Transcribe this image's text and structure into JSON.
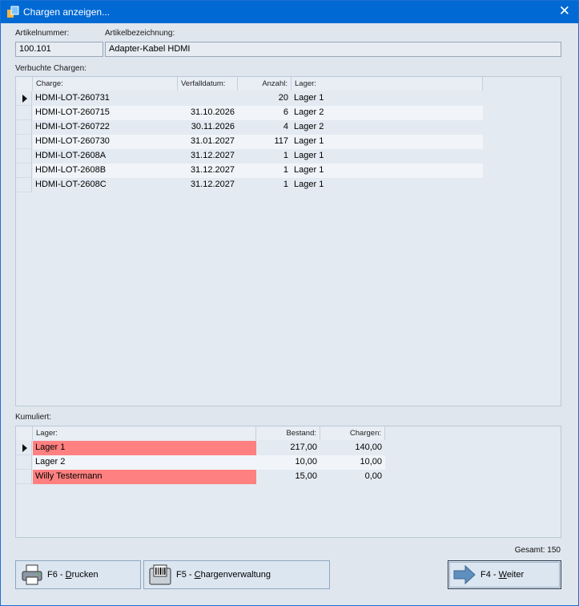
{
  "window": {
    "title": "Chargen anzeigen...",
    "close_glyph": "✕",
    "accent": "#0069d4"
  },
  "article": {
    "number_label": "Artikelnummer:",
    "number_value": "100.101",
    "desc_label": "Artikelbezeichnung:",
    "desc_value": "Adapter-Kabel HDMI"
  },
  "booked": {
    "section_label": "Verbuchte Chargen:",
    "columns": {
      "charge": "Charge:",
      "expiry": "Verfalldatum:",
      "count": "Anzahl:",
      "storage": "Lager:"
    },
    "rows": [
      {
        "charge": "HDMI-LOT-260731",
        "expiry": "",
        "count": "20",
        "storage": "Lager 1"
      },
      {
        "charge": "HDMI-LOT-260715",
        "expiry": "31.10.2026",
        "count": "6",
        "storage": "Lager 2"
      },
      {
        "charge": "HDMI-LOT-260722",
        "expiry": "30.11.2026",
        "count": "4",
        "storage": "Lager 2"
      },
      {
        "charge": "HDMI-LOT-260730",
        "expiry": "31.01.2027",
        "count": "117",
        "storage": "Lager 1"
      },
      {
        "charge": "HDMI-LOT-2608A",
        "expiry": "31.12.2027",
        "count": "1",
        "storage": "Lager 1"
      },
      {
        "charge": "HDMI-LOT-2608B",
        "expiry": "31.12.2027",
        "count": "1",
        "storage": "Lager 1"
      },
      {
        "charge": "HDMI-LOT-2608C",
        "expiry": "31.12.2027",
        "count": "1",
        "storage": "Lager 1"
      }
    ]
  },
  "cumulative": {
    "section_label": "Kumuliert:",
    "columns": {
      "storage": "Lager:",
      "stock": "Bestand:",
      "charges": "Chargen:"
    },
    "rows": [
      {
        "storage": "Lager 1",
        "stock": "217,00",
        "charges": "140,00",
        "highlight": true
      },
      {
        "storage": "Lager 2",
        "stock": "10,00",
        "charges": "10,00",
        "highlight": false
      },
      {
        "storage": "Willy Testermann",
        "stock": "15,00",
        "charges": "0,00",
        "highlight": true
      }
    ],
    "highlight_color": "#ff8080"
  },
  "total": "Gesamt: 150",
  "buttons": {
    "print": {
      "prefix": "F6 - ",
      "mnemonic": "D",
      "rest": "rucken",
      "icon": "printer-icon"
    },
    "manage": {
      "prefix": "F5 - ",
      "mnemonic": "C",
      "rest": "hargenverwaltung",
      "icon": "barcode-printer-icon"
    },
    "next": {
      "prefix": "F4 - ",
      "mnemonic": "W",
      "rest": "eiter",
      "icon": "arrow-right-icon"
    }
  }
}
